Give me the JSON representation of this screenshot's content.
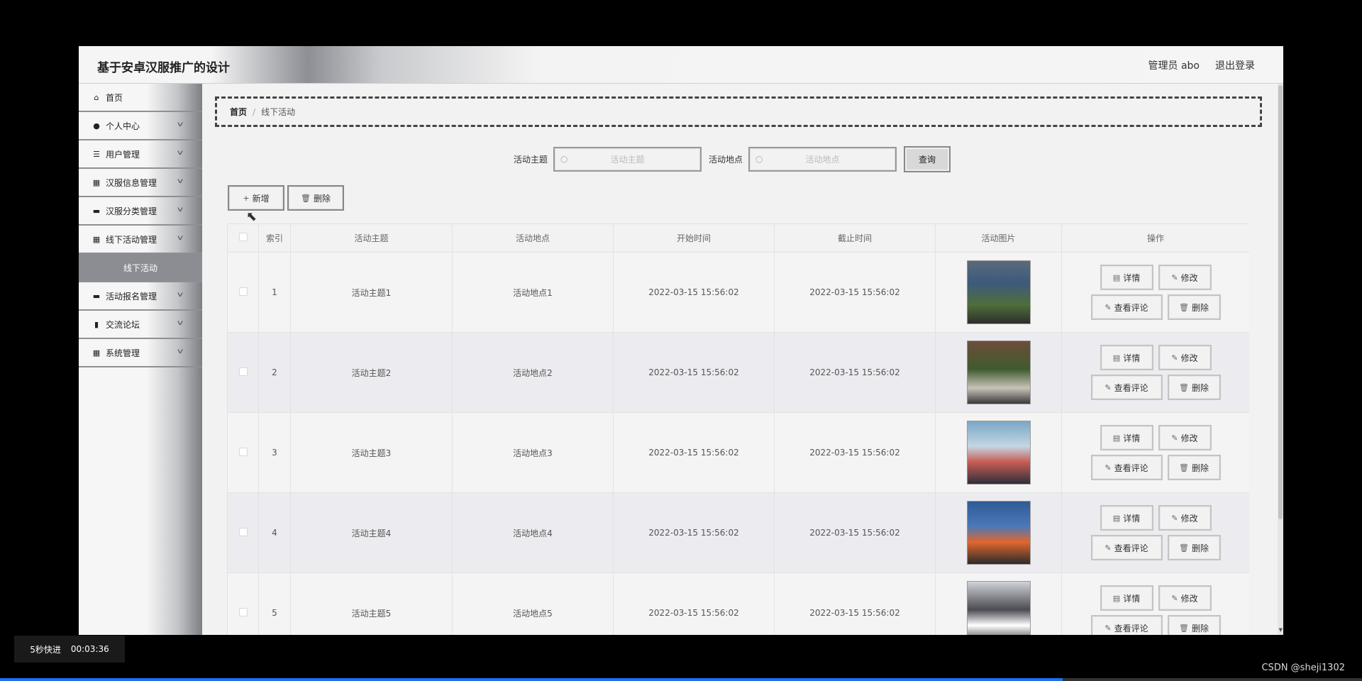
{
  "header": {
    "title": "基于安卓汉服推广的设计",
    "admin_label": "管理员 abo",
    "logout_label": "退出登录"
  },
  "sidebar": {
    "items": [
      {
        "label": "首页",
        "icon": "home-icon",
        "glyph": "⌂",
        "has_children": false
      },
      {
        "label": "个人中心",
        "icon": "user-icon",
        "glyph": "●",
        "has_children": true
      },
      {
        "label": "用户管理",
        "icon": "list-icon",
        "glyph": "☰",
        "has_children": true
      },
      {
        "label": "汉服信息管理",
        "icon": "grid-icon",
        "glyph": "▦",
        "has_children": true
      },
      {
        "label": "汉服分类管理",
        "icon": "monitor-icon",
        "glyph": "▬",
        "has_children": true
      },
      {
        "label": "线下活动管理",
        "icon": "grid-icon",
        "glyph": "▦",
        "has_children": true
      },
      {
        "label": "活动报名管理",
        "icon": "chat-icon",
        "glyph": "▬",
        "has_children": true
      },
      {
        "label": "交流论坛",
        "icon": "clipboard-icon",
        "glyph": "▮",
        "has_children": true
      },
      {
        "label": "系统管理",
        "icon": "grid-icon",
        "glyph": "▦",
        "has_children": true
      }
    ],
    "active_sub": "线下活动"
  },
  "breadcrumb": {
    "home": "首页",
    "separator": "/",
    "current": "线下活动"
  },
  "search": {
    "topic_label": "活动主题",
    "topic_placeholder": "活动主题",
    "place_label": "活动地点",
    "place_placeholder": "活动地点",
    "query_label": "查询"
  },
  "actions": {
    "add_label": "新增",
    "delete_label": "删除"
  },
  "table": {
    "columns": [
      "索引",
      "活动主题",
      "活动地点",
      "开始时间",
      "截止时间",
      "活动图片",
      "操作"
    ],
    "rows": [
      {
        "index": "1",
        "topic": "活动主题1",
        "place": "活动地点1",
        "start": "2022-03-15 15:56:02",
        "end": "2022-03-15 15:56:02"
      },
      {
        "index": "2",
        "topic": "活动主题2",
        "place": "活动地点2",
        "start": "2022-03-15 15:56:02",
        "end": "2022-03-15 15:56:02"
      },
      {
        "index": "3",
        "topic": "活动主题3",
        "place": "活动地点3",
        "start": "2022-03-15 15:56:02",
        "end": "2022-03-15 15:56:02"
      },
      {
        "index": "4",
        "topic": "活动主题4",
        "place": "活动地点4",
        "start": "2022-03-15 15:56:02",
        "end": "2022-03-15 15:56:02"
      },
      {
        "index": "5",
        "topic": "活动主题5",
        "place": "活动地点5",
        "start": "2022-03-15 15:56:02",
        "end": "2022-03-15 15:56:02"
      }
    ],
    "row_ops": {
      "detail": "详情",
      "edit": "修改",
      "comments": "查看评论",
      "delete": "删除"
    }
  },
  "player": {
    "speed_label": "5秒快进",
    "time": "00:03:36",
    "progress": 0.78
  },
  "watermark": "CSDN @sheji1302",
  "colors": {
    "sidebar_active": "#8b8d92",
    "progress": "#1e6ff0"
  }
}
